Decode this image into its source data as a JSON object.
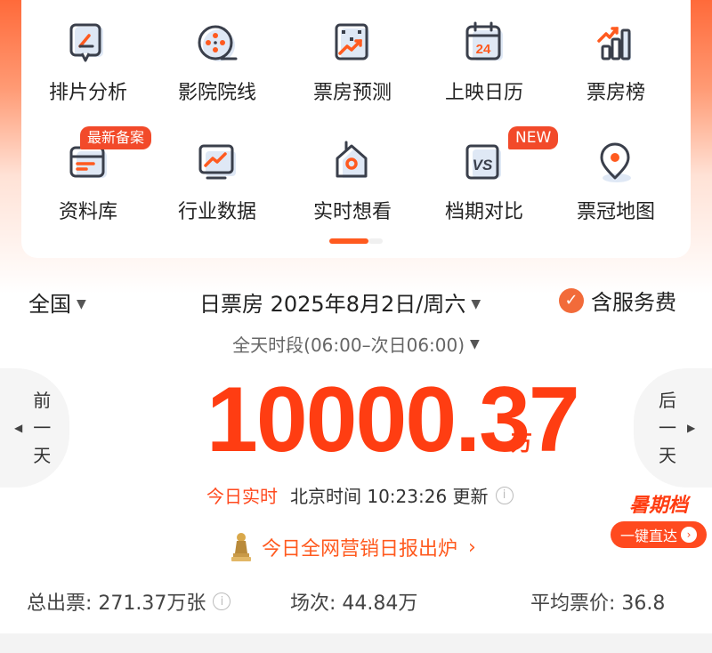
{
  "menu": {
    "row1": [
      {
        "label": "排片分析",
        "icon": "schedule-analysis-icon"
      },
      {
        "label": "影院院线",
        "icon": "film-reel-icon"
      },
      {
        "label": "票房预测",
        "icon": "forecast-icon"
      },
      {
        "label": "上映日历",
        "icon": "calendar-icon",
        "icon_text": "24"
      },
      {
        "label": "票房榜",
        "icon": "ranking-icon"
      }
    ],
    "row2": [
      {
        "label": "资料库",
        "icon": "database-icon",
        "badge": "最新备案"
      },
      {
        "label": "行业数据",
        "icon": "industry-chart-icon"
      },
      {
        "label": "实时想看",
        "icon": "want-to-watch-icon"
      },
      {
        "label": "档期对比",
        "icon": "versus-icon",
        "icon_text": "VS",
        "badge": "NEW"
      },
      {
        "label": "票冠地图",
        "icon": "map-pin-icon"
      }
    ],
    "page_indicator": {
      "pages": 2,
      "active": 1
    }
  },
  "filters": {
    "region": "全国",
    "date": "日票房 2025年8月2日/周六",
    "service_fee": "含服务费",
    "period": "全天时段(06:00–次日06:00)"
  },
  "nav": {
    "prev": [
      "前",
      "一",
      "天"
    ],
    "next": [
      "后",
      "一",
      "天"
    ]
  },
  "boxoffice": {
    "value": "10000.37",
    "unit": "万",
    "live_label": "今日实时",
    "update_time": "北京时间 10:23:26 更新"
  },
  "promo": {
    "title": "暑期档",
    "button": "一键直达"
  },
  "report": {
    "text": "今日全网营销日报出炉"
  },
  "stats": {
    "tickets": "总出票: 271.37万张",
    "shows": "场次: 44.84万",
    "avg_price": "平均票价: 36.8"
  },
  "colors": {
    "accent": "#ff3d12",
    "badge": "#f24a2a",
    "icon_orange": "#ff5a1f",
    "icon_dark": "#3a3f4b",
    "icon_light": "#dfe8f5"
  }
}
